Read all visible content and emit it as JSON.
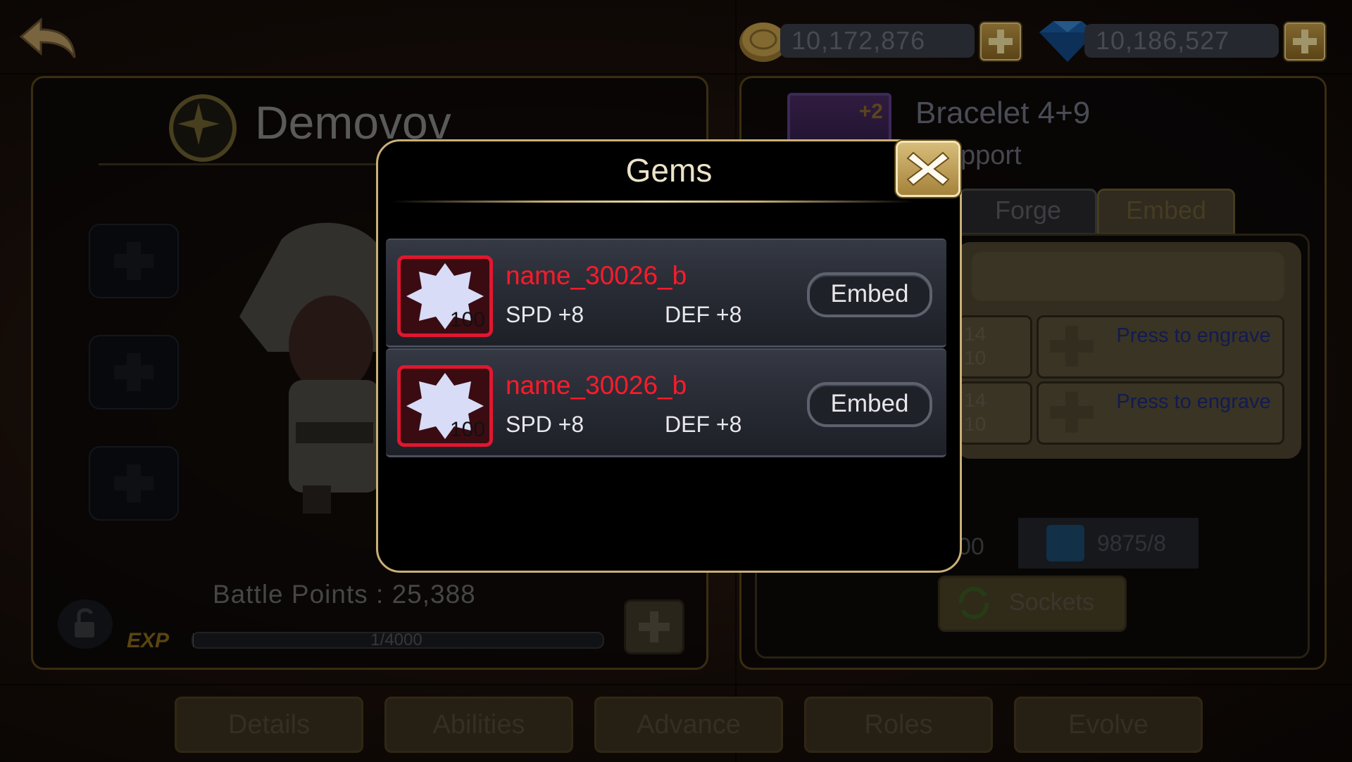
{
  "currency": {
    "gold": "10,172,876",
    "gems": "10,186,527"
  },
  "hero": {
    "name": "Demovov",
    "battle_points": "Battle Points : 25,388",
    "exp_label": "EXP",
    "exp_progress": "1/4000",
    "exp_fraction": 0.00025
  },
  "item": {
    "name": "Bracelet 4+9",
    "subtitle": "pport",
    "icon_badge": "+2",
    "tabs": [
      "Forge",
      "Embed"
    ],
    "active_tab": "Embed",
    "engrave_slots": [
      {
        "partial_a": "14",
        "partial_b": "10",
        "label": "Press to engrave"
      },
      {
        "partial_a": "14",
        "partial_b": "10",
        "label": "Press to engrave"
      }
    ],
    "partial_value": "00",
    "material_count": "9875/8",
    "sockets_label": "Sockets"
  },
  "bottom_tabs": [
    "Details",
    "Abilities",
    "Advance",
    "Roles",
    "Evolve"
  ],
  "modal": {
    "title": "Gems",
    "gems": [
      {
        "name": "name_30026_b",
        "level": "100",
        "stat1": "SPD +8",
        "stat2": "DEF +8",
        "action": "Embed"
      },
      {
        "name": "name_30026_b",
        "level": "100",
        "stat1": "SPD +8",
        "stat2": "DEF +8",
        "action": "Embed"
      }
    ]
  },
  "colors": {
    "modal_border": "#c9b076",
    "gem_name": "#ff1a2a",
    "gem_frame": "#e0172f"
  }
}
